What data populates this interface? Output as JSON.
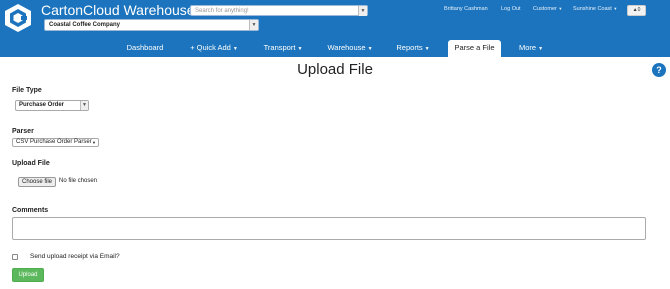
{
  "header": {
    "app_title": "CartonCloud Warehouse",
    "company": "Coastal Coffee Company",
    "search_placeholder": "Search for anything!",
    "user_name": "Brittany Cashman",
    "logout_label": "Log Out",
    "customer_menu": "Customer",
    "location_menu": "Sunshine Coast",
    "notifications_count": "0",
    "brand_color": "#1b74bd"
  },
  "nav": {
    "items": [
      {
        "label": "Dashboard"
      },
      {
        "label": "+ Quick Add"
      },
      {
        "label": "Transport"
      },
      {
        "label": "Warehouse"
      },
      {
        "label": "Reports"
      },
      {
        "label": "Parse a File"
      },
      {
        "label": "More"
      }
    ],
    "active": "Parse a File"
  },
  "page": {
    "title": "Upload File",
    "file_type_label": "File Type",
    "file_type_value": "Purchase Order",
    "parser_label": "Parser",
    "parser_value": "CSV Purchase Order Parser",
    "upload_label": "Upload File",
    "choose_file_button": "Choose file",
    "file_status": "No file chosen",
    "comments_label": "Comments",
    "email_receipt_label": "Send upload receipt via Email?",
    "upload_button": "Upload",
    "upload_button_color": "#5cb85c"
  }
}
